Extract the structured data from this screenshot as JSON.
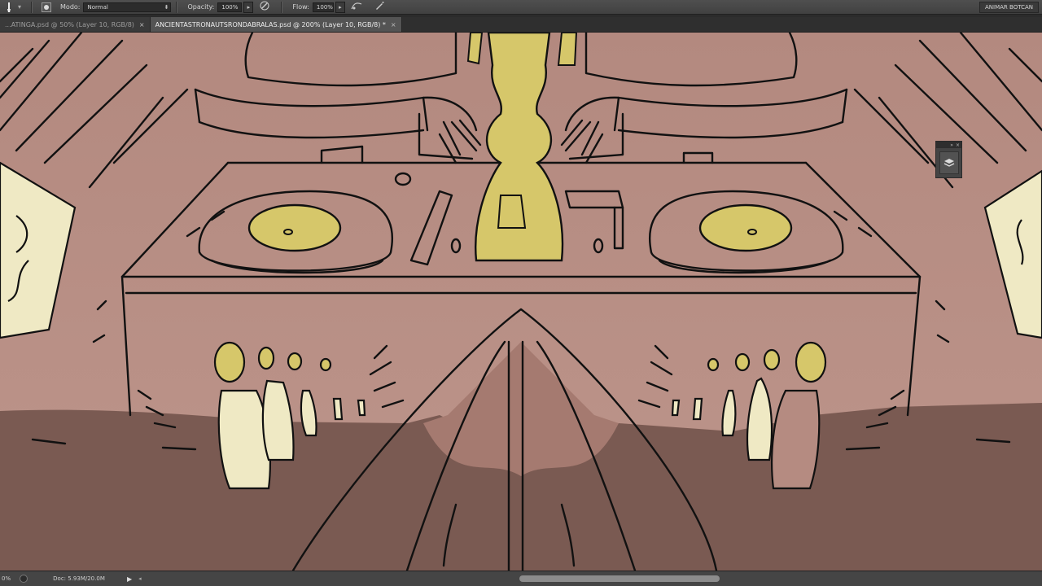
{
  "options_bar": {
    "tool_icon": "brush-tool-icon",
    "brush_preset_icon": "brush-preset-icon",
    "mode_label": "Modo:",
    "mode_value": "Normal",
    "opacity_label": "Opacity:",
    "opacity_value": "100%",
    "pressure_opacity_icon": "pen-pressure-opacity-icon",
    "flow_label": "Flow:",
    "flow_value": "100%",
    "airbrush_icon": "airbrush-icon",
    "pressure_size_icon": "pen-pressure-size-icon",
    "workspace_label": "ANIMAR BOTCAN"
  },
  "tabs": [
    {
      "label": "...ATINGA.psd @ 50% (Layer 10, RGB/8)",
      "active": false
    },
    {
      "label": "ANCIENTASTRONAUTSRONDABRALAS.psd @ 200% (Layer 10, RGB/8) *",
      "active": true
    }
  ],
  "layers_panel": {
    "icon": "layers-icon"
  },
  "status_bar": {
    "zoom": "0%",
    "doc_info": "Doc: 5.93M/20.0M"
  },
  "colors": {
    "wall": "#b58b81",
    "floor": "#7a5a52",
    "yellow": "#d6c76a",
    "cream": "#efe9c4",
    "line": "#111111",
    "ui_dark": "#454545"
  }
}
